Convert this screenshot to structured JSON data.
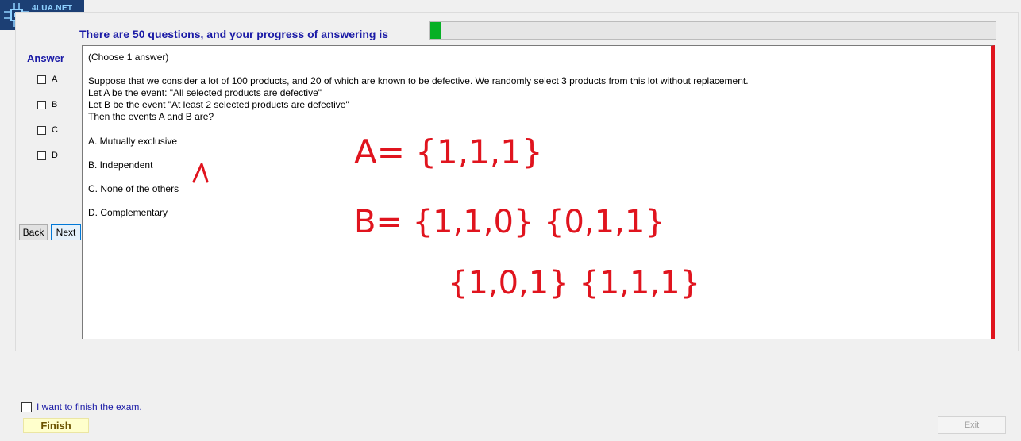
{
  "logo": {
    "text": "4LUA.NET",
    "badge": "?"
  },
  "progress": {
    "text": "There are 50 questions, and your progress of answering is",
    "value_fraction": 0.02
  },
  "answer_panel": {
    "title": "Answer",
    "options": [
      "A",
      "B",
      "C",
      "D"
    ],
    "back_label": "Back",
    "next_label": "Next"
  },
  "question": {
    "instruction": "(Choose 1 answer)",
    "stem": [
      "Suppose that we consider a lot of 100 products, and 20 of which are known to be defective. We randomly select 3 products from this lot without replacement.",
      "Let A be the event: \"All selected products are defective\"",
      "Let B be the event \"At least 2 selected products are defective\"",
      "Then the events A and B are?"
    ],
    "choices": [
      "A.  Mutually exclusive",
      "B.  Independent",
      "C.  None of the others",
      "D.  Complementary"
    ]
  },
  "handwriting": {
    "color": "#e0141e",
    "line1": "A= {1,1,1}",
    "line2": "B= {1,1,0}  {0,1,1}",
    "line3": "{1,0,1}  {1,1,1}"
  },
  "footer": {
    "finish_checkbox_label": "I want to finish the exam.",
    "finish_label": "Finish",
    "exit_label": "Exit"
  },
  "colors": {
    "accent_text": "#1a1aa6",
    "progress_fill": "#06b025",
    "question_border": "#e0141e",
    "finish_bg": "#ffffcc"
  }
}
